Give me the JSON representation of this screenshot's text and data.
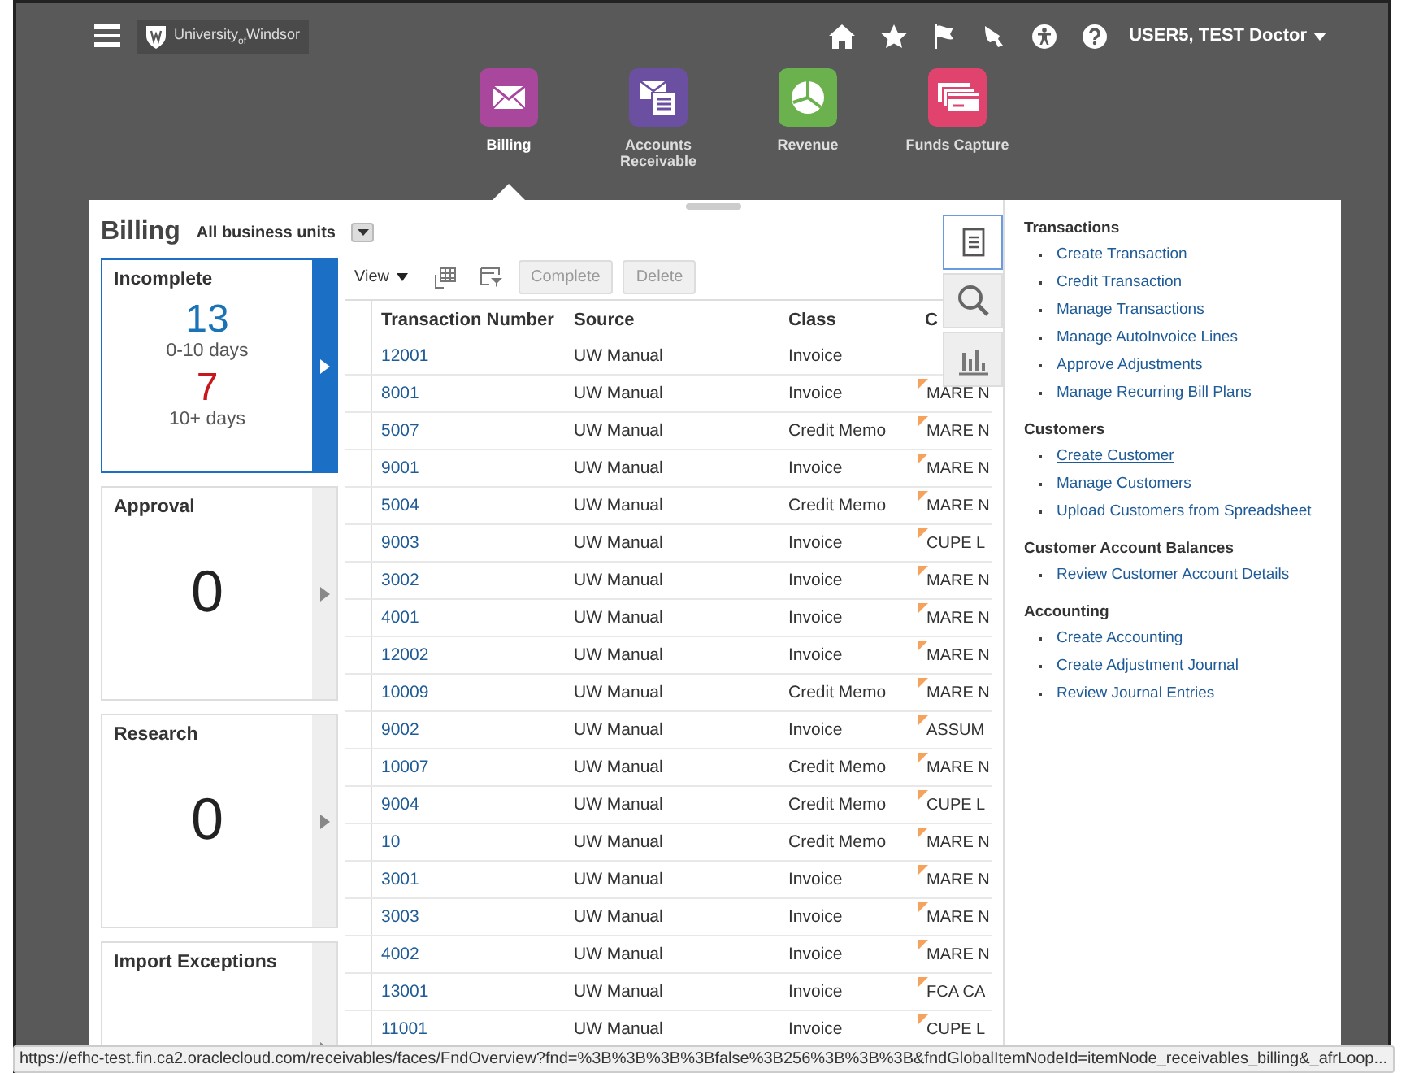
{
  "header": {
    "logo": "University$_{of}$Windsor",
    "user": "USER5, TEST Doctor"
  },
  "springboard": [
    {
      "label": "Billing",
      "color": "#a9479d",
      "kind": "mail",
      "selected": true
    },
    {
      "label": "Accounts Receivable",
      "color": "#6b4fa0",
      "kind": "ledger",
      "selected": false
    },
    {
      "label": "Revenue",
      "color": "#6bb14e",
      "kind": "pie",
      "selected": false
    },
    {
      "label": "Funds Capture",
      "color": "#e0446e",
      "kind": "cards",
      "selected": false
    }
  ],
  "panel": {
    "title": "Billing",
    "business_unit": "All business units"
  },
  "tiles": [
    {
      "title": "Incomplete",
      "selected": true,
      "metrics": [
        {
          "value": "13",
          "label": "0-10 days",
          "color": "#1a73b6"
        },
        {
          "value": "7",
          "label": "10+ days",
          "color": "#c8161d"
        }
      ]
    },
    {
      "title": "Approval",
      "selected": false,
      "metrics": [
        {
          "value": "0",
          "color": "#222222"
        }
      ]
    },
    {
      "title": "Research",
      "selected": false,
      "metrics": [
        {
          "value": "0",
          "color": "#222222"
        }
      ]
    },
    {
      "title": "Import Exceptions",
      "selected": false
    }
  ],
  "toolbar": {
    "view": "View",
    "buttons": [
      {
        "label": "Complete",
        "disabled": true
      },
      {
        "label": "Delete",
        "disabled": true
      }
    ]
  },
  "table": {
    "columns": [
      "Transaction Number",
      "Source",
      "Class",
      "C"
    ],
    "rows": [
      {
        "number": "12001",
        "source": "UW Manual",
        "class": "Invoice"
      },
      {
        "number": "8001",
        "source": "UW Manual",
        "class": "Invoice",
        "column_4": "MARE N"
      },
      {
        "number": "5007",
        "source": "UW Manual",
        "class": "Credit Memo",
        "column_4": "MARE N"
      },
      {
        "number": "9001",
        "source": "UW Manual",
        "class": "Invoice",
        "column_4": "MARE N"
      },
      {
        "number": "5004",
        "source": "UW Manual",
        "class": "Credit Memo",
        "column_4": "MARE N"
      },
      {
        "number": "9003",
        "source": "UW Manual",
        "class": "Invoice",
        "column_4": "CUPE L"
      },
      {
        "number": "3002",
        "source": "UW Manual",
        "class": "Invoice",
        "column_4": "MARE N"
      },
      {
        "number": "4001",
        "source": "UW Manual",
        "class": "Invoice",
        "column_4": "MARE N"
      },
      {
        "number": "12002",
        "source": "UW Manual",
        "class": "Invoice",
        "column_4": "MARE N"
      },
      {
        "number": "10009",
        "source": "UW Manual",
        "class": "Credit Memo",
        "column_4": "MARE N"
      },
      {
        "number": "9002",
        "source": "UW Manual",
        "class": "Invoice",
        "column_4": "ASSUM"
      },
      {
        "number": "10007",
        "source": "UW Manual",
        "class": "Credit Memo",
        "column_4": "MARE N"
      },
      {
        "number": "9004",
        "source": "UW Manual",
        "class": "Credit Memo",
        "column_4": "CUPE L"
      },
      {
        "number": "10",
        "source": "UW Manual",
        "class": "Credit Memo",
        "column_4": "MARE N"
      },
      {
        "number": "3001",
        "source": "UW Manual",
        "class": "Invoice",
        "column_4": "MARE N"
      },
      {
        "number": "3003",
        "source": "UW Manual",
        "class": "Invoice",
        "column_4": "MARE N"
      },
      {
        "number": "4002",
        "source": "UW Manual",
        "class": "Invoice",
        "column_4": "MARE N"
      },
      {
        "number": "13001",
        "source": "UW Manual",
        "class": "Invoice",
        "column_4": "FCA CA"
      },
      {
        "number": "11001",
        "source": "UW Manual",
        "class": "Invoice",
        "column_4": "CUPE L"
      }
    ]
  },
  "side_tabs": [
    {
      "kind": "tasks",
      "selected": true
    },
    {
      "kind": "search",
      "selected": false
    },
    {
      "kind": "reports",
      "selected": false
    }
  ],
  "tasks": [
    {
      "heading": "Transactions",
      "links": [
        {
          "label": "Create Transaction",
          "hovered": false
        },
        {
          "label": "Credit Transaction",
          "hovered": false
        },
        {
          "label": "Manage Transactions",
          "hovered": false
        },
        {
          "label": "Manage AutoInvoice Lines",
          "hovered": false
        },
        {
          "label": "Approve Adjustments",
          "hovered": false
        },
        {
          "label": "Manage Recurring Bill Plans",
          "hovered": false
        }
      ]
    },
    {
      "heading": "Customers",
      "links": [
        {
          "label": "Create Customer",
          "hovered": true
        },
        {
          "label": "Manage Customers",
          "hovered": false
        },
        {
          "label": "Upload Customers from Spreadsheet",
          "hovered": false
        }
      ]
    },
    {
      "heading": "Customer Account Balances",
      "links": [
        {
          "label": "Review Customer Account Details",
          "hovered": false
        }
      ]
    },
    {
      "heading": "Accounting",
      "links": [
        {
          "label": "Create Accounting",
          "hovered": false
        },
        {
          "label": "Create Adjustment Journal",
          "hovered": false
        },
        {
          "label": "Review Journal Entries",
          "hovered": false
        }
      ]
    }
  ],
  "status_bar": {
    "url": "https://efhc-test.fin.ca2.oraclecloud.com/receivables/faces/FndOverview?fnd=%3B%3B%3B%3Bfalse%3B256%3B%3B%3B&fndGlobalItemNodeId=itemNode_receivables_billing&_afrLoop..."
  }
}
